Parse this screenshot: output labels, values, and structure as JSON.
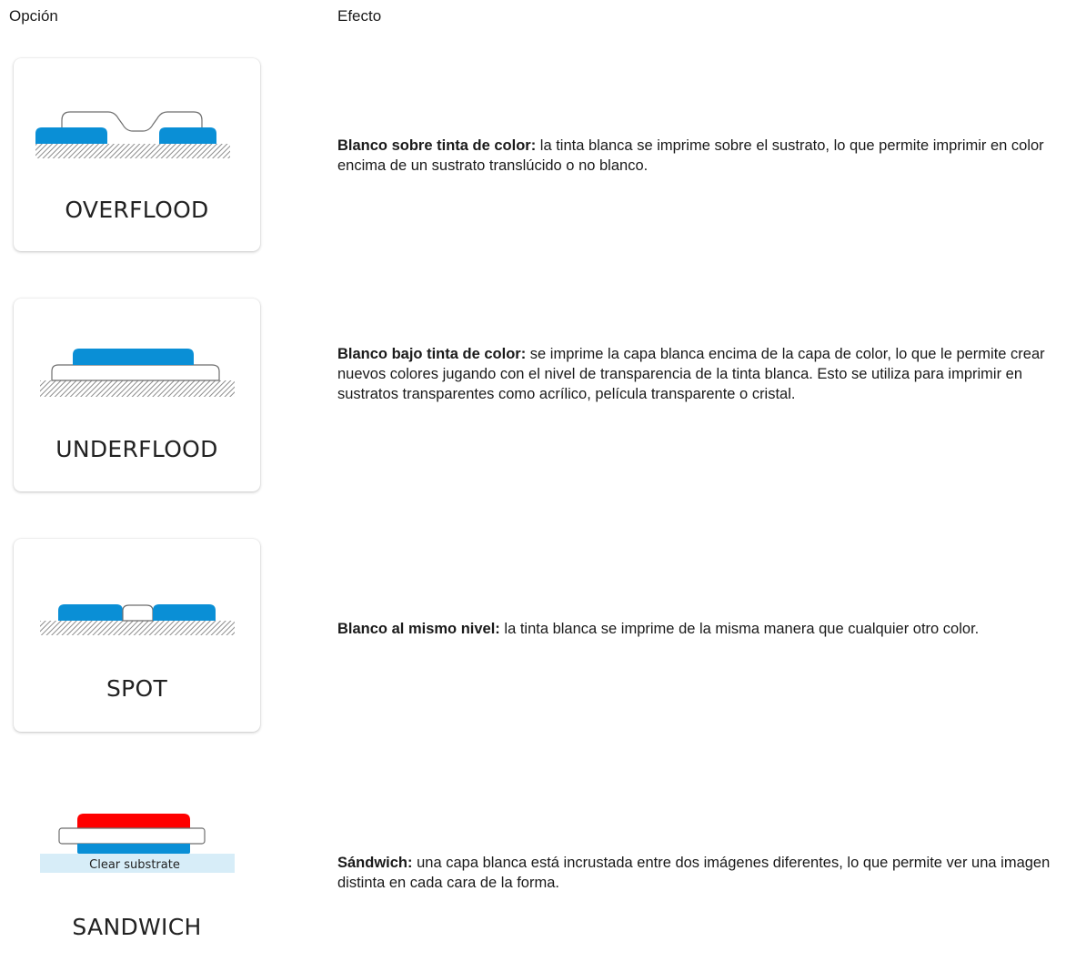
{
  "headers": {
    "option": "Opción",
    "effect": "Efecto"
  },
  "colors": {
    "ink_blue": "#0a8fd6",
    "ink_red": "#ff0000",
    "clear_substrate": "#d7edf8",
    "substrate_hatch": "#8c8c8c",
    "white_ink_outline": "#6e6e6e"
  },
  "rows": [
    {
      "option": "OVERFLOOD",
      "term": "Blanco sobre tinta de color:",
      "text": " la tinta blanca se imprime sobre el sustrato, lo que permite imprimir en color encima de un sustrato translúcido o no blanco."
    },
    {
      "option": "UNDERFLOOD",
      "term": "Blanco bajo tinta de color:",
      "text": " se imprime la capa blanca encima de la capa de color, lo que le permite crear nuevos colores jugando con el nivel de transparencia de la tinta blanca. Esto se utiliza para imprimir en sustratos transparentes como acrílico, película transparente o cristal."
    },
    {
      "option": "SPOT",
      "term": "Blanco al mismo nivel:",
      "text": " la tinta blanca se imprime de la misma manera que cualquier otro color."
    },
    {
      "option": "SANDWICH",
      "substrate_label": "Clear substrate",
      "term": "Sándwich:",
      "text": " una capa blanca está incrustada entre dos imágenes diferentes, lo que permite ver una imagen distinta en cada cara de la forma."
    }
  ]
}
